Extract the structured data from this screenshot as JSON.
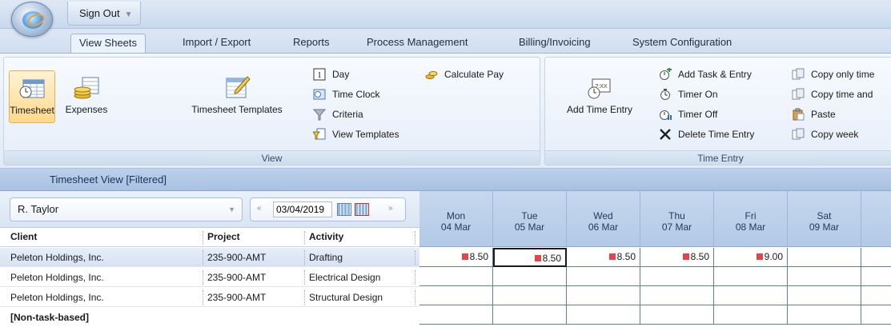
{
  "app": {
    "sign_out_label": "Sign Out"
  },
  "tabs": [
    {
      "label": "View Sheets",
      "active": true
    },
    {
      "label": "Import / Export"
    },
    {
      "label": "Reports"
    },
    {
      "label": "Process Management"
    },
    {
      "label": "Billing/Invoicing"
    },
    {
      "label": "System Configuration"
    }
  ],
  "ribbon": {
    "view_group": {
      "label": "View",
      "big_buttons": [
        "Timesheet",
        "Expenses",
        "Timesheet Templates"
      ],
      "small_buttons": [
        "Day",
        "Time Clock",
        "Criteria",
        "View Templates"
      ],
      "calculate_pay": "Calculate Pay"
    },
    "time_entry_group": {
      "label": "Time Entry",
      "add_time_entry": "Add Time Entry",
      "small_buttons": [
        "Add Task & Entry",
        "Timer On",
        "Timer Off",
        "Delete Time Entry"
      ],
      "copy_buttons": [
        "Copy only time",
        "Copy time and",
        "Paste",
        "Copy week"
      ]
    }
  },
  "view_title": "Timesheet View [Filtered]",
  "filters": {
    "employee": "R. Taylor",
    "date": "03/04/2019"
  },
  "columns": {
    "client": "Client",
    "project": "Project",
    "activity": "Activity"
  },
  "days": [
    {
      "name": "Mon",
      "date": "04 Mar"
    },
    {
      "name": "Tue",
      "date": "05 Mar"
    },
    {
      "name": "Wed",
      "date": "06 Mar"
    },
    {
      "name": "Thu",
      "date": "07 Mar"
    },
    {
      "name": "Fri",
      "date": "08 Mar"
    },
    {
      "name": "Sat",
      "date": "09 Mar"
    }
  ],
  "rows": [
    {
      "client": "Peleton Holdings, Inc.",
      "project": "235-900-AMT",
      "activity": "Drafting",
      "hours": [
        "8.50",
        "8.50",
        "8.50",
        "8.50",
        "9.00",
        ""
      ]
    },
    {
      "client": "Peleton Holdings, Inc.",
      "project": "235-900-AMT",
      "activity": "Electrical Design",
      "hours": [
        "",
        "",
        "",
        "",
        "",
        ""
      ]
    },
    {
      "client": "Peleton Holdings, Inc.",
      "project": "235-900-AMT",
      "activity": "Structural Design",
      "hours": [
        "",
        "",
        "",
        "",
        "",
        ""
      ]
    }
  ],
  "non_task_label": "[Non-task-based]"
}
